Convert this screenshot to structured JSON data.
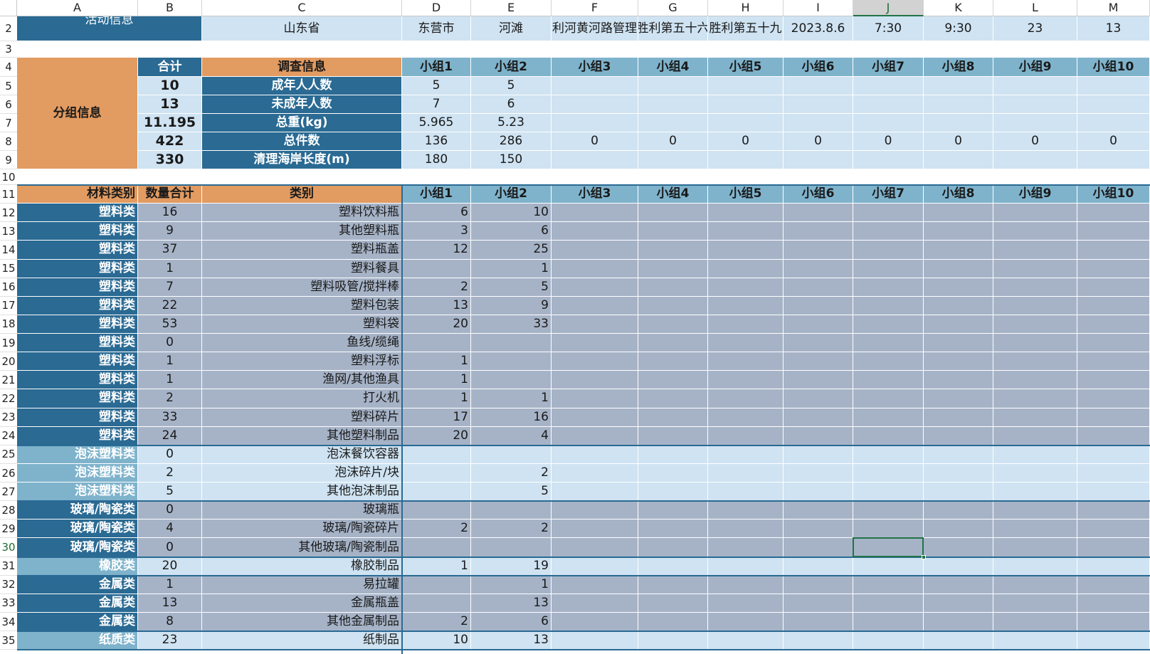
{
  "columns": [
    "A",
    "B",
    "C",
    "D",
    "E",
    "F",
    "G",
    "H",
    "I",
    "J",
    "K",
    "L",
    "M"
  ],
  "selected_column": "J",
  "selected_row": "30",
  "row_numbers": [
    "2",
    "3",
    "4",
    "5",
    "6",
    "7",
    "8",
    "9",
    "10",
    "11",
    "12",
    "13",
    "14",
    "15",
    "16",
    "17",
    "18",
    "19",
    "20",
    "21",
    "22",
    "23",
    "24",
    "25",
    "26",
    "27",
    "28",
    "29",
    "30",
    "31",
    "32",
    "33",
    "34",
    "35"
  ],
  "activity": {
    "label": "活动信息",
    "province": "山东省",
    "city": "东营市",
    "site_type": "河滩",
    "location": "利河黄河路管理",
    "org1": "胜利第五十六",
    "org2": "胜利第五十九",
    "date": "2023.8.6",
    "start_time": "7:30",
    "end_time": "9:30",
    "temperature": "23",
    "extra": "13"
  },
  "group_info": {
    "label": "分组信息",
    "total_header": "合计",
    "survey_header": "调查信息",
    "groups": [
      "小组1",
      "小组2",
      "小组3",
      "小组4",
      "小组5",
      "小组6",
      "小组7",
      "小组8",
      "小组9",
      "小组10"
    ],
    "rows": [
      {
        "total": "10",
        "label": "成年人人数",
        "values": [
          "5",
          "5",
          "",
          "",
          "",
          "",
          "",
          "",
          "",
          ""
        ]
      },
      {
        "total": "13",
        "label": "未成年人数",
        "values": [
          "7",
          "6",
          "",
          "",
          "",
          "",
          "",
          "",
          "",
          ""
        ]
      },
      {
        "total": "11.195",
        "label": "总重(kg)",
        "values": [
          "5.965",
          "5.23",
          "",
          "",
          "",
          "",
          "",
          "",
          "",
          ""
        ]
      },
      {
        "total": "422",
        "label": "总件数",
        "values": [
          "136",
          "286",
          "0",
          "0",
          "0",
          "0",
          "0",
          "0",
          "0",
          "0"
        ]
      },
      {
        "total": "330",
        "label": "清理海岸长度(m)",
        "values": [
          "180",
          "150",
          "",
          "",
          "",
          "",
          "",
          "",
          "",
          ""
        ]
      }
    ]
  },
  "items_table": {
    "header": {
      "material": "材料类别",
      "qty": "数量合计",
      "category": "类别"
    },
    "rows": [
      {
        "material": "塑料类",
        "qty": "16",
        "category": "塑料饮料瓶",
        "g1": "6",
        "g2": "10",
        "style": "gray"
      },
      {
        "material": "塑料类",
        "qty": "9",
        "category": "其他塑料瓶",
        "g1": "3",
        "g2": "6",
        "style": "gray"
      },
      {
        "material": "塑料类",
        "qty": "37",
        "category": "塑料瓶盖",
        "g1": "12",
        "g2": "25",
        "style": "gray"
      },
      {
        "material": "塑料类",
        "qty": "1",
        "category": "塑料餐具",
        "g1": "",
        "g2": "1",
        "style": "gray"
      },
      {
        "material": "塑料类",
        "qty": "7",
        "category": "塑料吸管/搅拌棒",
        "g1": "2",
        "g2": "5",
        "style": "gray"
      },
      {
        "material": "塑料类",
        "qty": "22",
        "category": "塑料包装",
        "g1": "13",
        "g2": "9",
        "style": "gray"
      },
      {
        "material": "塑料类",
        "qty": "53",
        "category": "塑料袋",
        "g1": "20",
        "g2": "33",
        "style": "gray"
      },
      {
        "material": "塑料类",
        "qty": "0",
        "category": "鱼线/缆绳",
        "g1": "",
        "g2": "",
        "style": "gray"
      },
      {
        "material": "塑料类",
        "qty": "1",
        "category": "塑料浮标",
        "g1": "1",
        "g2": "",
        "style": "gray"
      },
      {
        "material": "塑料类",
        "qty": "1",
        "category": "渔网/其他渔具",
        "g1": "1",
        "g2": "",
        "style": "gray"
      },
      {
        "material": "塑料类",
        "qty": "2",
        "category": "打火机",
        "g1": "1",
        "g2": "1",
        "style": "gray"
      },
      {
        "material": "塑料类",
        "qty": "33",
        "category": "塑料碎片",
        "g1": "17",
        "g2": "16",
        "style": "gray"
      },
      {
        "material": "塑料类",
        "qty": "24",
        "category": "其他塑料制品",
        "g1": "20",
        "g2": "4",
        "style": "gray"
      },
      {
        "material": "泡沫塑料类",
        "qty": "0",
        "category": "泡沫餐饮容器",
        "g1": "",
        "g2": "",
        "style": "light"
      },
      {
        "material": "泡沫塑料类",
        "qty": "2",
        "category": "泡沫碎片/块",
        "g1": "",
        "g2": "2",
        "style": "light"
      },
      {
        "material": "泡沫塑料类",
        "qty": "5",
        "category": "其他泡沫制品",
        "g1": "",
        "g2": "5",
        "style": "light"
      },
      {
        "material": "玻璃/陶瓷类",
        "qty": "0",
        "category": "玻璃瓶",
        "g1": "",
        "g2": "",
        "style": "gray"
      },
      {
        "material": "玻璃/陶瓷类",
        "qty": "4",
        "category": "玻璃/陶瓷碎片",
        "g1": "2",
        "g2": "2",
        "style": "gray"
      },
      {
        "material": "玻璃/陶瓷类",
        "qty": "0",
        "category": "其他玻璃/陶瓷制品",
        "g1": "",
        "g2": "",
        "style": "gray"
      },
      {
        "material": "橡胶类",
        "qty": "20",
        "category": "橡胶制品",
        "g1": "1",
        "g2": "19",
        "style": "light"
      },
      {
        "material": "金属类",
        "qty": "1",
        "category": "易拉罐",
        "g1": "",
        "g2": "1",
        "style": "gray"
      },
      {
        "material": "金属类",
        "qty": "13",
        "category": "金属瓶盖",
        "g1": "",
        "g2": "13",
        "style": "gray"
      },
      {
        "material": "金属类",
        "qty": "8",
        "category": "其他金属制品",
        "g1": "2",
        "g2": "6",
        "style": "gray"
      },
      {
        "material": "纸质类",
        "qty": "23",
        "category": "纸制品",
        "g1": "10",
        "g2": "13",
        "style": "light"
      }
    ]
  },
  "colors": {
    "dark_blue": "#2a6a93",
    "orange": "#e29b61",
    "teal": "#7fb3cc",
    "light_blue": "#cfe3f2",
    "gray_blue": "#a6b3c7",
    "excel_green": "#217346"
  }
}
